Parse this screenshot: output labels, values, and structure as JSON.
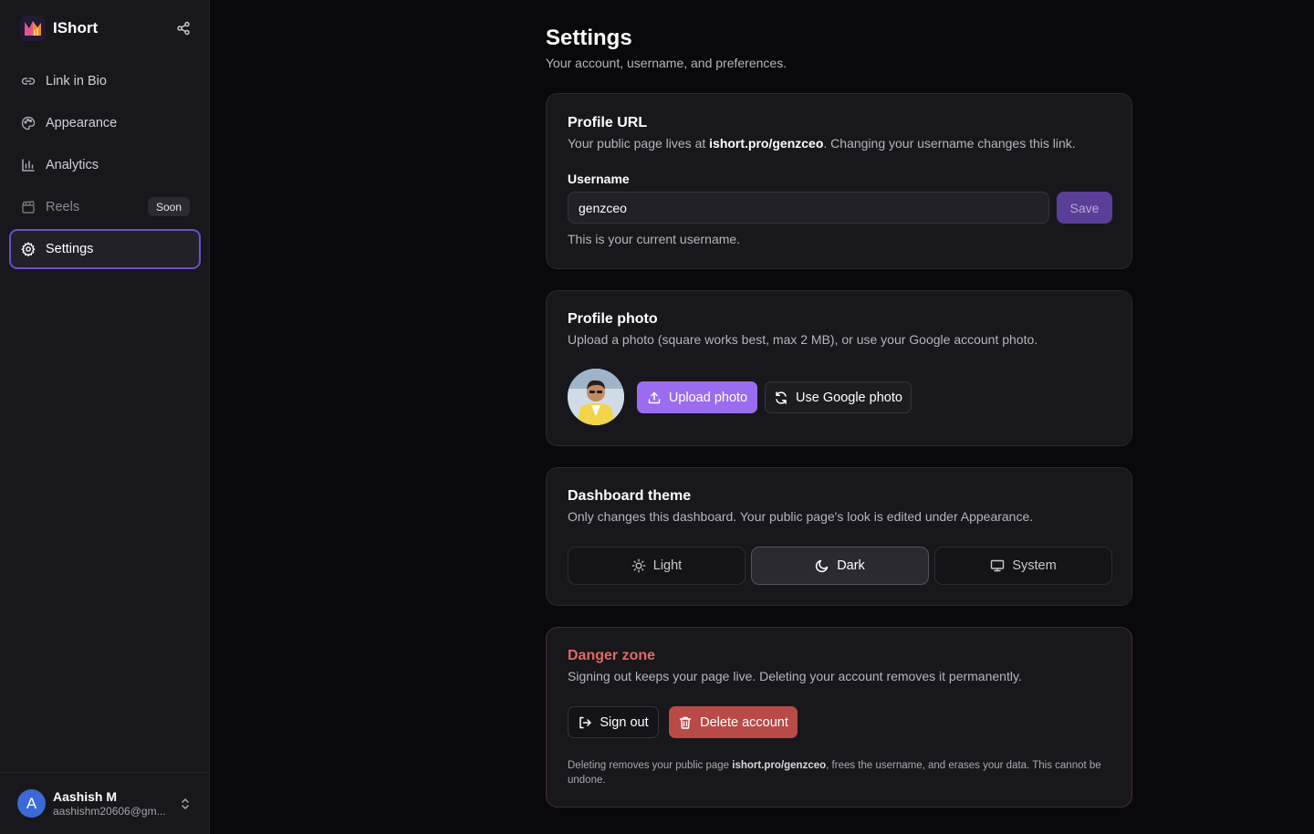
{
  "app": {
    "name": "IShort"
  },
  "sidebar": {
    "items": [
      {
        "label": "Link in Bio",
        "icon": "link-icon"
      },
      {
        "label": "Appearance",
        "icon": "palette-icon"
      },
      {
        "label": "Analytics",
        "icon": "bar-chart-icon"
      },
      {
        "label": "Reels",
        "icon": "clapperboard-icon",
        "badge": "Soon"
      },
      {
        "label": "Settings",
        "icon": "gear-icon",
        "active": true
      }
    ],
    "user": {
      "initial": "A",
      "name": "Aashish M",
      "email": "aashishm20606@gm..."
    }
  },
  "page": {
    "title": "Settings",
    "subtitle": "Your account, username, and preferences."
  },
  "profile_url": {
    "title": "Profile URL",
    "desc_before": "Your public page lives at ",
    "desc_link": "ishort.pro/genzceo",
    "desc_after": ". Changing your username changes this link.",
    "username_label": "Username",
    "username_value": "genzceo",
    "save_label": "Save",
    "hint": "This is your current username."
  },
  "profile_photo": {
    "title": "Profile photo",
    "desc": "Upload a photo (square works best, max 2 MB), or use your Google account photo.",
    "upload_label": "Upload photo",
    "google_label": "Use Google photo"
  },
  "theme": {
    "title": "Dashboard theme",
    "desc": "Only changes this dashboard. Your public page's look is edited under Appearance.",
    "options": [
      {
        "label": "Light",
        "icon": "sun-icon"
      },
      {
        "label": "Dark",
        "icon": "moon-icon",
        "selected": true
      },
      {
        "label": "System",
        "icon": "monitor-icon"
      }
    ]
  },
  "danger": {
    "title": "Danger zone",
    "desc": "Signing out keeps your page live. Deleting your account removes it permanently.",
    "signout_label": "Sign out",
    "delete_label": "Delete account",
    "fine_before": "Deleting removes your public page ",
    "fine_link": "ishort.pro/genzceo",
    "fine_after": ", frees the username, and erases your data. This cannot be undone."
  },
  "colors": {
    "accent": "#9b6cf0",
    "danger": "#b84a48",
    "background": "#09080b",
    "card": "#18171c"
  }
}
